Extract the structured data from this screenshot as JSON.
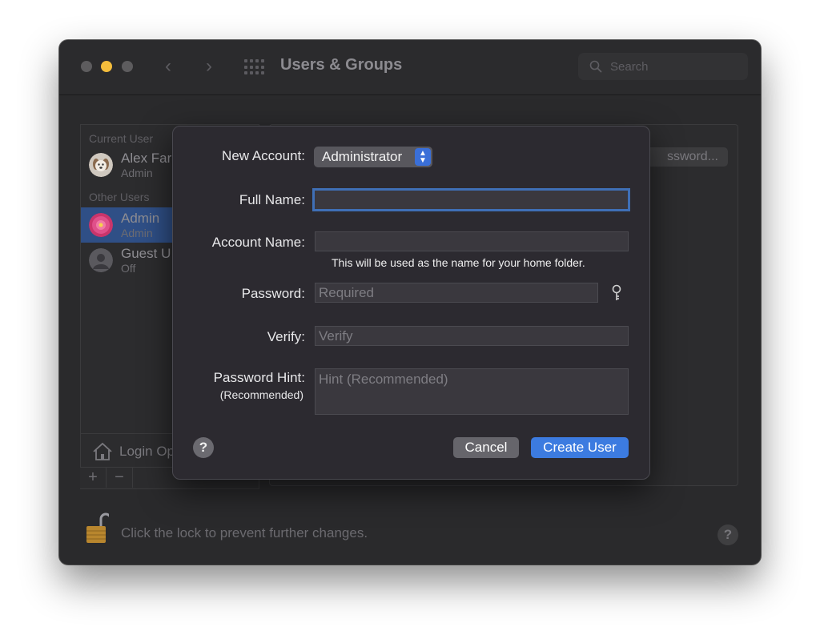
{
  "window": {
    "title": "Users & Groups",
    "search_placeholder": "Search"
  },
  "sidebar": {
    "current_user_header": "Current User",
    "other_users_header": "Other Users",
    "users": [
      {
        "name": "Alex Far",
        "role": "Admin"
      },
      {
        "name": "Admin",
        "role": "Admin"
      },
      {
        "name": "Guest U",
        "role": "Off"
      }
    ],
    "login_options_label": "Login Op",
    "add_label": "+",
    "remove_label": "−"
  },
  "background": {
    "password_button_label": "ssword...",
    "lock_text": "Click the lock to prevent further changes.",
    "help_label": "?"
  },
  "dialog": {
    "new_account_label": "New Account:",
    "new_account_value": "Administrator",
    "full_name_label": "Full Name:",
    "full_name_value": "",
    "account_name_label": "Account Name:",
    "account_name_value": "",
    "account_name_note": "This will be used as the name for your home folder.",
    "password_label": "Password:",
    "password_placeholder": "Required",
    "verify_label": "Verify:",
    "verify_placeholder": "Verify",
    "hint_label": "Password Hint:",
    "hint_sublabel": "(Recommended)",
    "hint_placeholder": "Hint (Recommended)",
    "help_label": "?",
    "cancel_label": "Cancel",
    "create_label": "Create User"
  },
  "colors": {
    "accent": "#3c7be0",
    "selection": "#2f4f86",
    "focus_ring": "#3f6fb6"
  }
}
